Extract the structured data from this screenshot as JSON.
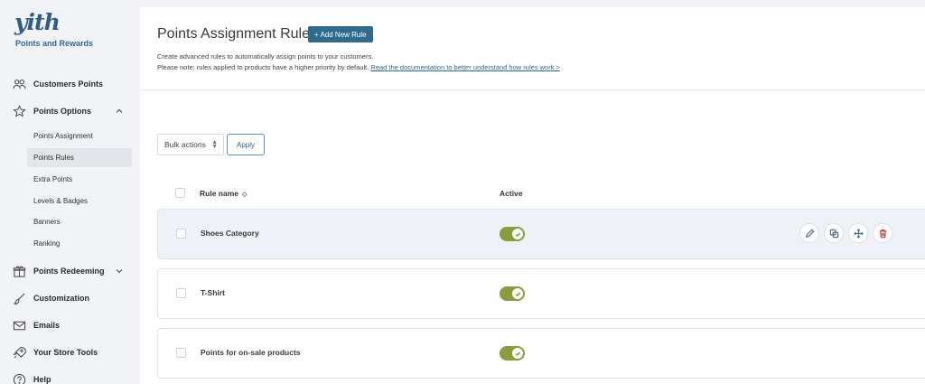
{
  "sidebar": {
    "logo": "yith",
    "plugin_name": "Points and Rewards",
    "items": [
      {
        "label": "Customers Points",
        "icon": "users-icon"
      },
      {
        "label": "Points Options",
        "icon": "star-icon",
        "expanded": true
      },
      {
        "label": "Points Redeeming",
        "icon": "gift-icon",
        "expanded": false
      },
      {
        "label": "Customization",
        "icon": "brush-icon"
      },
      {
        "label": "Emails",
        "icon": "mail-icon"
      },
      {
        "label": "Your Store Tools",
        "icon": "rocket-icon"
      },
      {
        "label": "Help",
        "icon": "help-icon"
      }
    ],
    "sub_items": [
      {
        "label": "Points Assignment"
      },
      {
        "label": "Points Rules",
        "active": true
      },
      {
        "label": "Extra Points"
      },
      {
        "label": "Levels & Badges"
      },
      {
        "label": "Banners"
      },
      {
        "label": "Ranking"
      }
    ]
  },
  "header": {
    "title": "Points Assignment Rules",
    "add_button": "+ Add New Rule",
    "description_line1": "Create advanced rules to automatically assign points to your customers.",
    "description_line2": "Please note: rules applied to products have a higher priority by default.",
    "doc_link": "Read the documentation to better understand how rules work >"
  },
  "toolbar": {
    "bulk_actions": "Bulk actions",
    "apply": "Apply"
  },
  "table": {
    "columns": [
      "Rule name",
      "Active"
    ],
    "rows": [
      {
        "name": "Shoes Category",
        "active": true
      },
      {
        "name": "T-Shirt",
        "active": true
      },
      {
        "name": "Points for on-sale products",
        "active": true
      }
    ]
  },
  "colors": {
    "accent": "#2f6b8f",
    "toggle_on": "#8b9c3c",
    "delete": "#c0453a"
  }
}
